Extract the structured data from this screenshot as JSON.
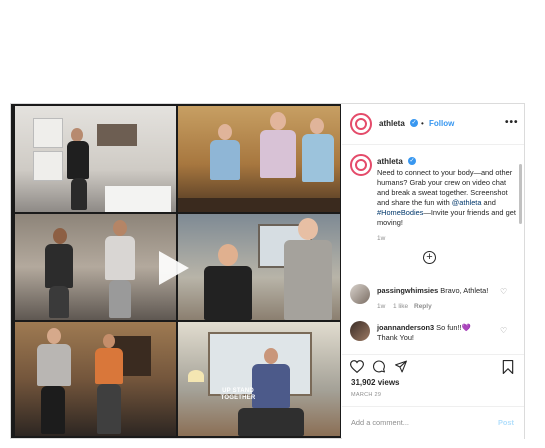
{
  "account": {
    "username": "athleta",
    "follow_label": "Follow",
    "separator": "•",
    "more_label": "•••"
  },
  "caption": {
    "username": "athleta",
    "text_parts": [
      "Need to connect to your body—and other humans? Grab your crew on video chat and break a sweat together. Screenshot and share the fun with ",
      "@athleta",
      " and ",
      "#HomeBodies",
      "—Invite your friends and get moving!"
    ],
    "time": "1w"
  },
  "load_more": "+",
  "comments": [
    {
      "username": "passingwhimsies",
      "text": "Bravo, Athleta!",
      "time": "1w",
      "likes": "1 like",
      "reply": "Reply"
    },
    {
      "username": "joannanderson3",
      "text": "So fun!!",
      "emoji": "💜",
      "text2": "Thank You!"
    }
  ],
  "media": {
    "shirt_text": "UP STAND TOGETHER",
    "play_icon": "play-icon"
  },
  "stats": {
    "views": "31,902 views",
    "date": "MARCH 29"
  },
  "add_comment": {
    "placeholder": "Add a comment...",
    "post_label": "Post"
  },
  "colors": {
    "accent": "#3897f0",
    "brand_ring": "#e44b6a",
    "muted": "#8e8e8e"
  }
}
